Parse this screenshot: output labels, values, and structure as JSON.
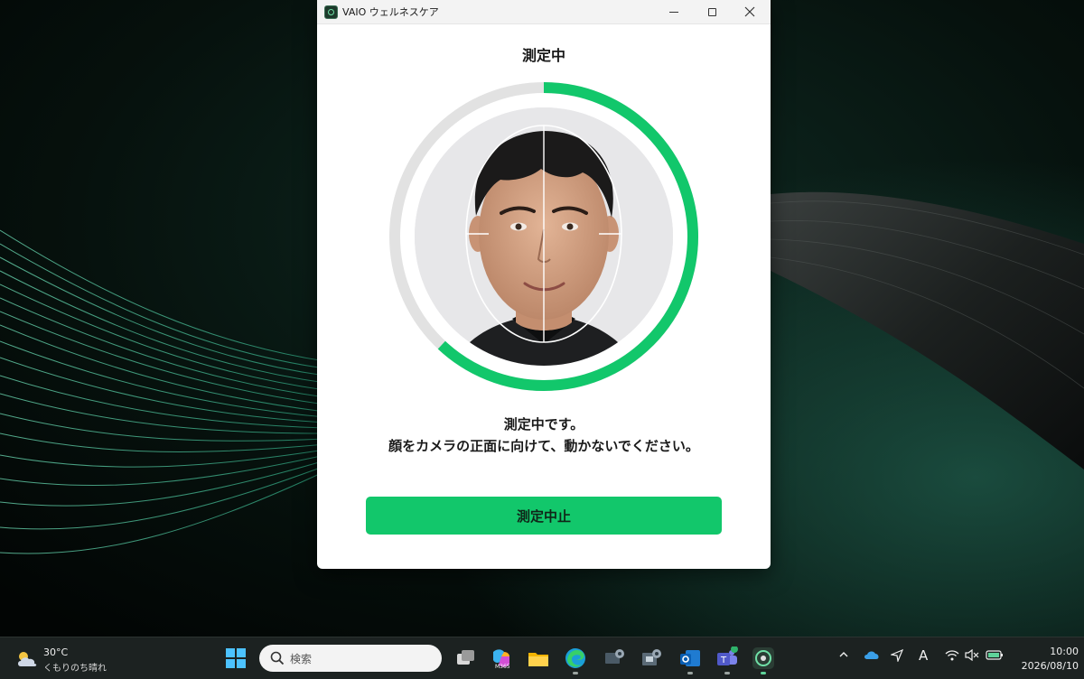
{
  "window": {
    "title": "VAIO ウェルネスケア",
    "status_title": "測定中",
    "message_line1": "測定中です。",
    "message_line2": "顔をカメラの正面に向けて、動かないでください。",
    "stop_button_label": "測定中止",
    "progress_fraction": 0.62,
    "accent_color": "#12c76b"
  },
  "taskbar": {
    "weather_temp": "30°C",
    "weather_desc": "くもりのち晴れ",
    "search_placeholder": "検索",
    "m365_label": "M365",
    "clock_time": "10:00",
    "clock_date": "2026/08/10",
    "input_indicator": "A"
  }
}
